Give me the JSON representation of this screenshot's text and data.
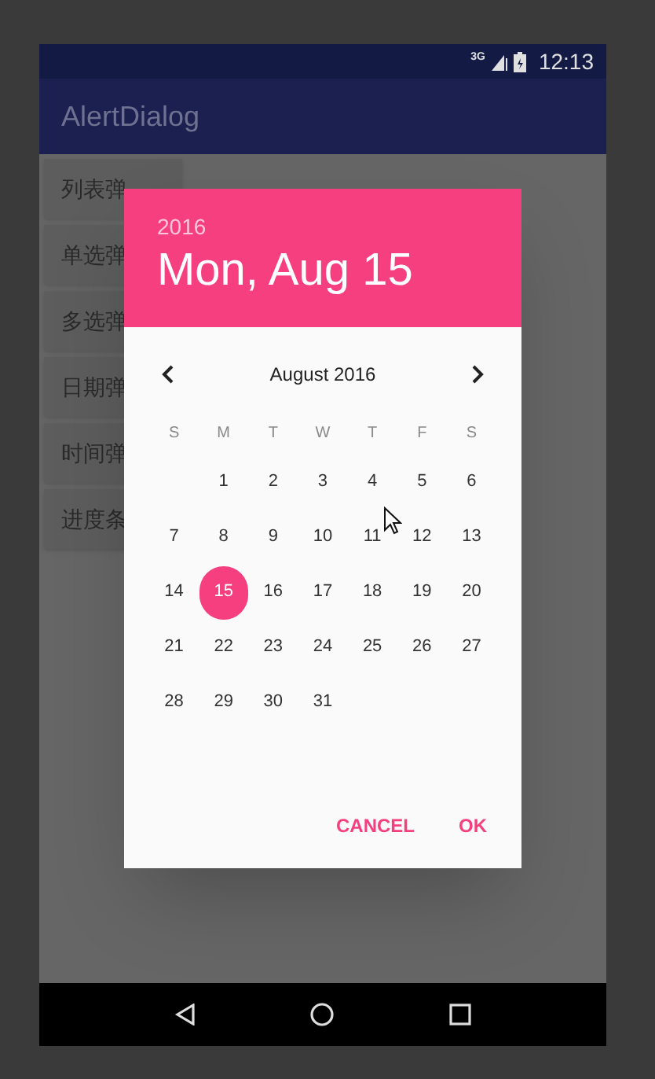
{
  "status_bar": {
    "network": "3G",
    "time": "12:13"
  },
  "app_bar": {
    "title": "AlertDialog"
  },
  "buttons": [
    "列表弹",
    "单选弹",
    "多选弹",
    "日期弹",
    "时间弹",
    "进度条"
  ],
  "dialog": {
    "year": "2016",
    "date": "Mon, Aug 15",
    "month_label": "August 2016",
    "weekdays": [
      "S",
      "M",
      "T",
      "W",
      "T",
      "F",
      "S"
    ],
    "weeks": [
      [
        {
          "label": "1",
          "selected": false
        },
        {
          "label": "2",
          "selected": false
        },
        {
          "label": "3",
          "selected": false
        },
        {
          "label": "4",
          "selected": false
        },
        {
          "label": "5",
          "selected": false
        },
        {
          "label": "6",
          "selected": false
        }
      ],
      [
        {
          "label": "7",
          "selected": false
        },
        {
          "label": "8",
          "selected": false
        },
        {
          "label": "9",
          "selected": false
        },
        {
          "label": "10",
          "selected": false
        },
        {
          "label": "11",
          "selected": false
        },
        {
          "label": "12",
          "selected": false
        },
        {
          "label": "13",
          "selected": false
        }
      ],
      [
        {
          "label": "14",
          "selected": false
        },
        {
          "label": "15",
          "selected": true
        },
        {
          "label": "16",
          "selected": false
        },
        {
          "label": "17",
          "selected": false
        },
        {
          "label": "18",
          "selected": false
        },
        {
          "label": "19",
          "selected": false
        },
        {
          "label": "20",
          "selected": false
        }
      ],
      [
        {
          "label": "21",
          "selected": false
        },
        {
          "label": "22",
          "selected": false
        },
        {
          "label": "23",
          "selected": false
        },
        {
          "label": "24",
          "selected": false
        },
        {
          "label": "25",
          "selected": false
        },
        {
          "label": "26",
          "selected": false
        },
        {
          "label": "27",
          "selected": false
        }
      ],
      [
        {
          "label": "28",
          "selected": false
        },
        {
          "label": "29",
          "selected": false
        },
        {
          "label": "30",
          "selected": false
        },
        {
          "label": "31",
          "selected": false
        }
      ]
    ],
    "actions": [
      "CANCEL",
      "OK"
    ]
  }
}
